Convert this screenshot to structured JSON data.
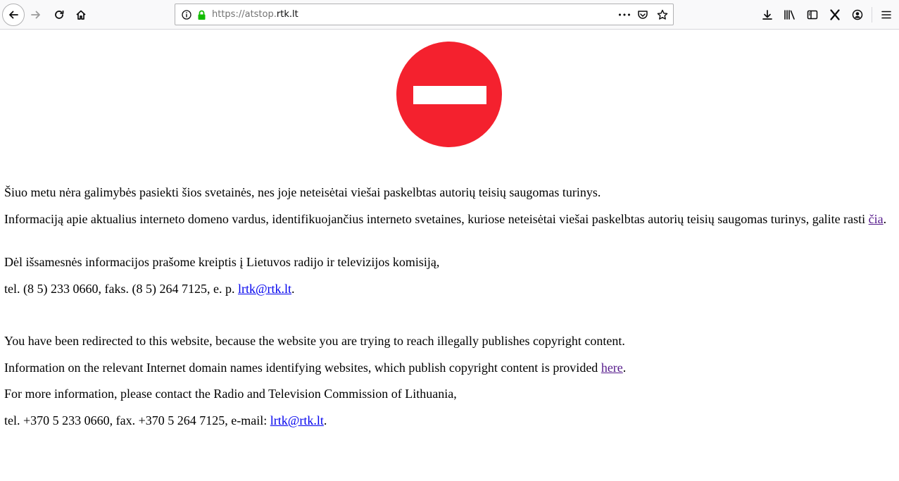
{
  "browser": {
    "url_prefix": "https://atstop.",
    "url_domain": "rtk.lt",
    "more_label": "•••"
  },
  "page": {
    "lt": {
      "p1": "Šiuo metu nėra galimybės pasiekti šios svetainės, nes joje neteisėtai viešai paskelbtas autorių teisių saugomas turinys.",
      "p2_text": "Informaciją apie aktualius interneto domeno vardus, identifikuojančius interneto svetaines, kuriose neteisėtai viešai paskelbtas autorių teisių saugomas turinys, galite rasti ",
      "p2_link": "čia",
      "p2_end": ".",
      "p3": "Dėl išsamesnės informacijos prašome kreiptis į Lietuvos radijo ir televizijos komisiją,",
      "p4_text": "tel. (8 5) 233 0660, faks. (8 5) 264 7125, e. p. ",
      "p4_link": "lrtk@rtk.lt",
      "p4_end": "."
    },
    "en": {
      "p1": "You have been redirected to this website, because the website you are trying to reach illegally publishes copyright content.",
      "p2_text": "Information on the relevant Internet domain names identifying websites, which publish copyright content is provided ",
      "p2_link": "here",
      "p2_end": ".",
      "p3": "For more information, please contact the Radio and Television Commission of Lithuania,",
      "p4_text": "tel. +370 5 233 0660, fax. +370 5 264 7125, e-mail: ",
      "p4_link": "lrtk@rtk.lt",
      "p4_end": "."
    }
  },
  "colors": {
    "stop_red": "#f4212e",
    "visited_link": "#551a8b",
    "link": "#0000ee",
    "secure_green": "#12bc00"
  }
}
